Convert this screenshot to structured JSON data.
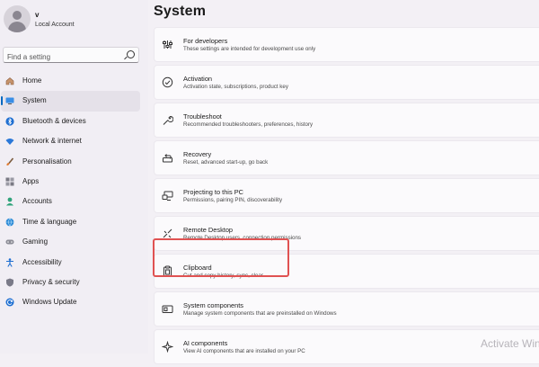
{
  "user": {
    "name": "v",
    "type": "Local Account"
  },
  "search": {
    "placeholder": "Find a setting"
  },
  "nav": [
    {
      "label": "Home",
      "icon": "home-icon",
      "active": false
    },
    {
      "label": "System",
      "icon": "system-icon",
      "active": true
    },
    {
      "label": "Bluetooth & devices",
      "icon": "bluetooth-icon",
      "active": false
    },
    {
      "label": "Network & internet",
      "icon": "wifi-icon",
      "active": false
    },
    {
      "label": "Personalisation",
      "icon": "brush-icon",
      "active": false
    },
    {
      "label": "Apps",
      "icon": "apps-icon",
      "active": false
    },
    {
      "label": "Accounts",
      "icon": "accounts-icon",
      "active": false
    },
    {
      "label": "Time & language",
      "icon": "globe-icon",
      "active": false
    },
    {
      "label": "Gaming",
      "icon": "gamepad-icon",
      "active": false
    },
    {
      "label": "Accessibility",
      "icon": "accessibility-icon",
      "active": false
    },
    {
      "label": "Privacy & security",
      "icon": "shield-icon",
      "active": false
    },
    {
      "label": "Windows Update",
      "icon": "update-icon",
      "active": false
    }
  ],
  "page": {
    "title": "System"
  },
  "items": [
    {
      "title": "For developers",
      "subtitle": "These settings are intended for development use only",
      "icon": "developer-tools-icon"
    },
    {
      "title": "Activation",
      "subtitle": "Activation state, subscriptions, product key",
      "icon": "check-circle-icon"
    },
    {
      "title": "Troubleshoot",
      "subtitle": "Recommended troubleshooters, preferences, history",
      "icon": "wrench-icon"
    },
    {
      "title": "Recovery",
      "subtitle": "Reset, advanced start-up, go back",
      "icon": "recovery-icon"
    },
    {
      "title": "Projecting to this PC",
      "subtitle": "Permissions, pairing PIN, discoverability",
      "icon": "projector-icon"
    },
    {
      "title": "Remote Desktop",
      "subtitle": "Remote Desktop users, connection permissions",
      "icon": "remote-desktop-icon"
    },
    {
      "title": "Clipboard",
      "subtitle": "Cut and copy history, sync, clear",
      "icon": "clipboard-icon"
    },
    {
      "title": "System components",
      "subtitle": "Manage system components that are preinstalled on Windows",
      "icon": "components-icon"
    },
    {
      "title": "AI components",
      "subtitle": "View AI components that are installed on your PC",
      "icon": "ai-icon"
    }
  ],
  "watermark": "Activate Wind",
  "colors": {
    "accent": "#0067c0",
    "highlight": "#e05252"
  }
}
